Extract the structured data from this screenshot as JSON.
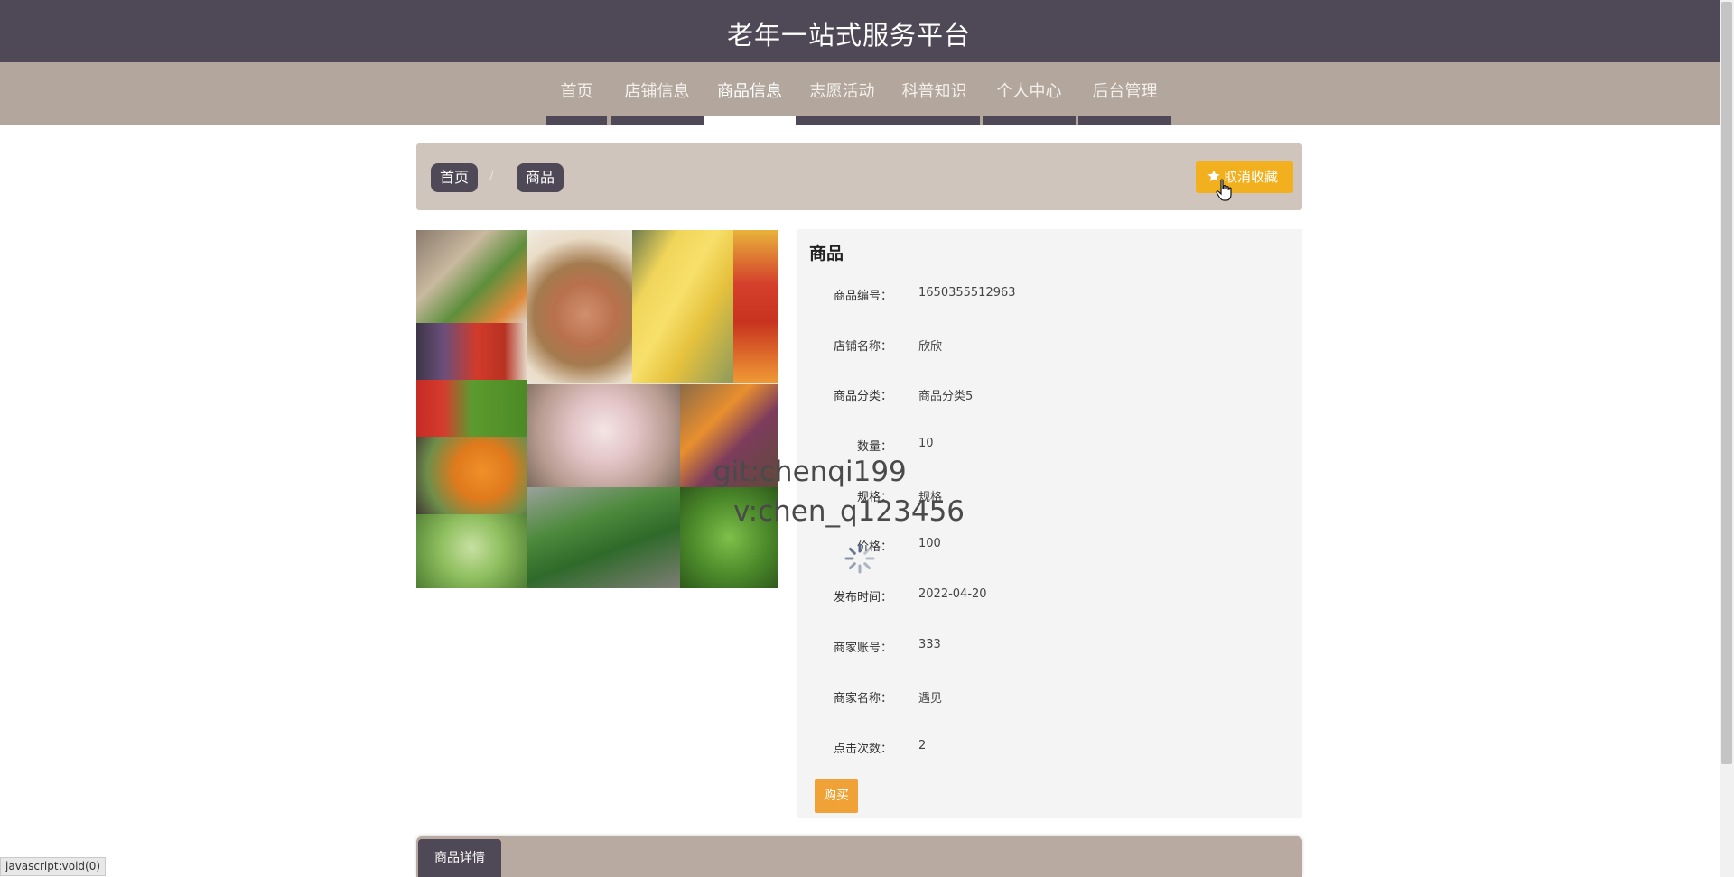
{
  "header": {
    "title": "老年一站式服务平台"
  },
  "nav": {
    "items": [
      {
        "label": "首页"
      },
      {
        "label": "店铺信息"
      },
      {
        "label": "商品信息"
      },
      {
        "label": "志愿活动"
      },
      {
        "label": "科普知识"
      },
      {
        "label": "个人中心"
      },
      {
        "label": "后台管理"
      }
    ],
    "active": "商品信息"
  },
  "breadcrumb": {
    "items": [
      {
        "label": "首页"
      },
      {
        "label": "商品"
      }
    ],
    "separator": "/"
  },
  "favorite_button": {
    "label": "取消收藏",
    "icon": "star-icon",
    "color": "#f2b01e"
  },
  "product": {
    "title": "商品",
    "fields": [
      {
        "label": "商品编号：",
        "value": "1650355512963"
      },
      {
        "label": "店铺名称：",
        "value": "欣欣"
      },
      {
        "label": "商品分类：",
        "value": "商品分类5"
      },
      {
        "label": "数量：",
        "value": "10"
      },
      {
        "label": "规格：",
        "value": "规格"
      },
      {
        "label": "价格：",
        "value": "100"
      },
      {
        "label": "发布时间：",
        "value": "2022-04-20"
      },
      {
        "label": "商家账号：",
        "value": "333"
      },
      {
        "label": "商家名称：",
        "value": "遇见"
      },
      {
        "label": "点击次数：",
        "value": "2"
      }
    ],
    "buy_label": "购买"
  },
  "watermark": {
    "line1": "git:chenqi199",
    "line2": "v:chen_q123456"
  },
  "tabs": [
    {
      "label": "商品详情"
    }
  ],
  "status_bar": "javascript:void(0)",
  "colors": {
    "header_bg": "#4f4856",
    "nav_bg": "#b3a69d",
    "breadcrumb_bg": "#cfc5bc",
    "buy": "#f0a236"
  }
}
